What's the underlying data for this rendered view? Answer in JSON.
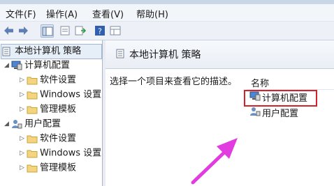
{
  "menubar": {
    "items": [
      "文件(F)",
      "操作(A)",
      "查看(V)",
      "帮助(H)"
    ]
  },
  "toolbar": {
    "buttons": [
      "back-icon",
      "forward-icon",
      "show-tree-icon",
      "properties-icon",
      "export-icon",
      "help-icon",
      "view-icon"
    ]
  },
  "tree": {
    "root": "本地计算机 策略",
    "computer": "计算机配置",
    "user": "用户配置",
    "software": "软件设置",
    "windows": "Windows 设置",
    "admin": "管理模板"
  },
  "right": {
    "header_title": "本地计算机 策略",
    "description": "选择一个项目来查看它的描述。",
    "column_name": "名称",
    "items": [
      "计算机配置",
      "用户配置"
    ]
  },
  "colors": {
    "highlight": "#d3222a",
    "arrow": "#e23be0"
  }
}
